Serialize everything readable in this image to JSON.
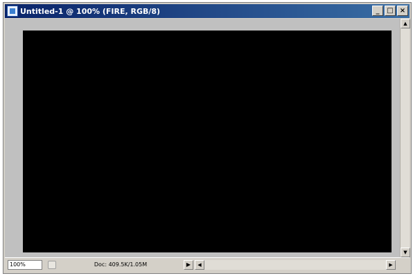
{
  "window": {
    "title": "Untitled-1 @ 100% (FIRE, RGB/8)",
    "controls": {
      "minimize": "_",
      "maximize": "□",
      "close": "×"
    },
    "canvas_color": "#000000"
  },
  "statusbar": {
    "zoom": "100%",
    "doc_info": "Doc: 409.5K/1.05M",
    "menu_arrow": "▶"
  },
  "scroll": {
    "up": "▲",
    "down": "▼",
    "left": "◀",
    "right": "▶"
  }
}
